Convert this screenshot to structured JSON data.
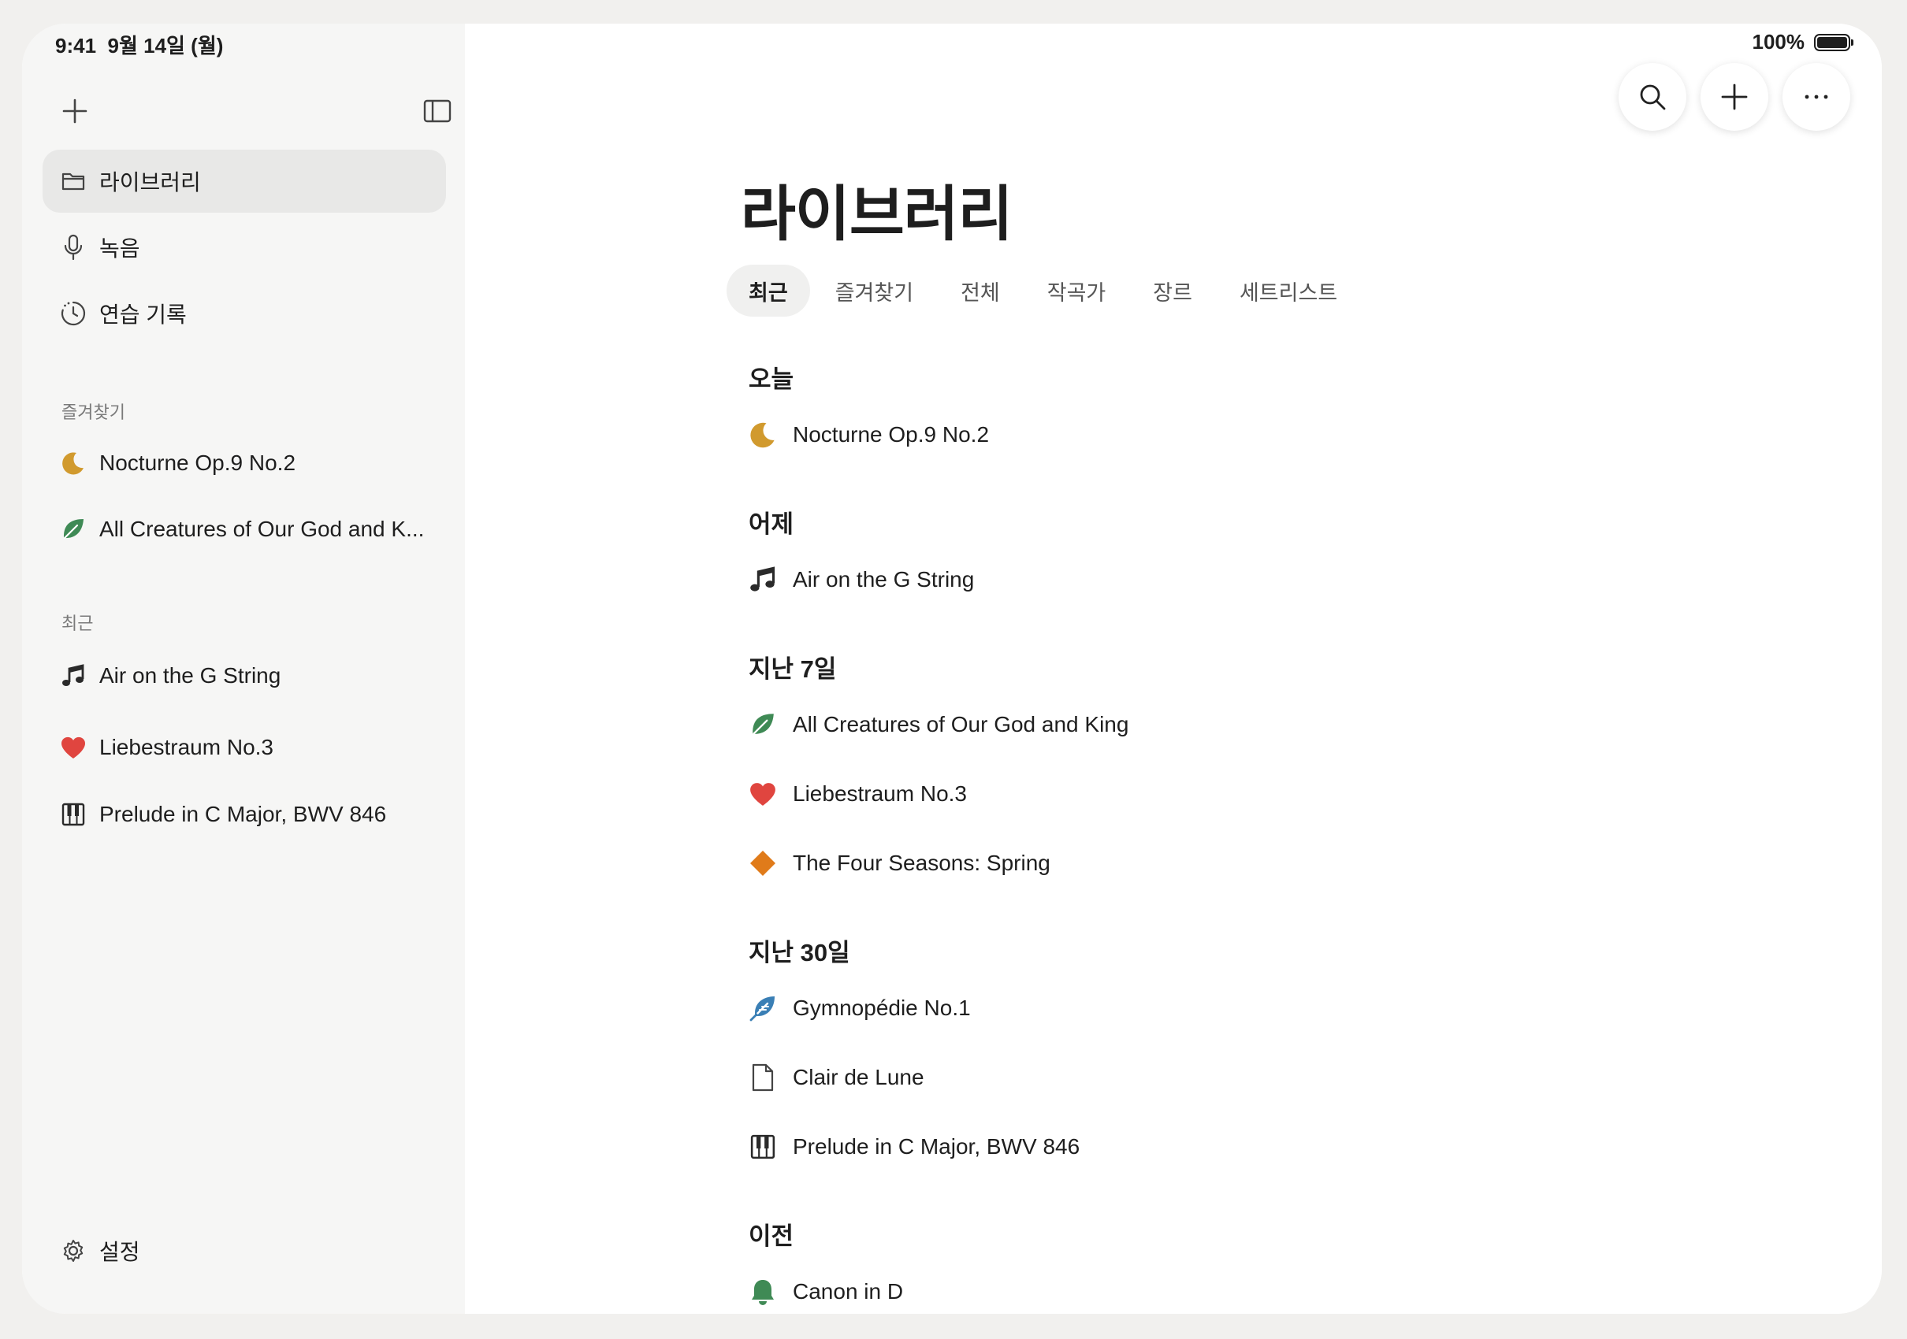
{
  "status": {
    "time": "9:41",
    "date": "9월 14일 (월)",
    "battery": "100%"
  },
  "sidebar": {
    "nav": [
      {
        "label": "라이브러리",
        "icon": "folder-icon",
        "active": true
      },
      {
        "label": "녹음",
        "icon": "microphone-icon"
      },
      {
        "label": "연습 기록",
        "icon": "history-icon"
      }
    ],
    "favorites_label": "즐겨찾기",
    "favorites": [
      {
        "label": "Nocturne Op.9 No.2",
        "icon": "moon-icon"
      },
      {
        "label": "All Creatures of Our God and K...",
        "icon": "leaf-icon"
      }
    ],
    "recent_label": "최근",
    "recent": [
      {
        "label": "Air on the G String",
        "icon": "music-note-icon"
      },
      {
        "label": "Liebestraum No.3",
        "icon": "heart-icon"
      },
      {
        "label": "Prelude in C Major, BWV 846",
        "icon": "piano-icon"
      }
    ],
    "settings_label": "설정"
  },
  "main": {
    "title": "라이브러리",
    "tabs": [
      "최근",
      "즐겨찾기",
      "전체",
      "작곡가",
      "장르",
      "세트리스트"
    ],
    "active_tab": "최근",
    "groups": [
      {
        "title": "오늘",
        "items": [
          {
            "label": "Nocturne Op.9 No.2",
            "icon": "moon-icon"
          }
        ]
      },
      {
        "title": "어제",
        "items": [
          {
            "label": "Air on the G String",
            "icon": "music-note-icon"
          }
        ]
      },
      {
        "title": "지난 7일",
        "items": [
          {
            "label": "All Creatures of Our God and King",
            "icon": "leaf-icon"
          },
          {
            "label": "Liebestraum No.3",
            "icon": "heart-icon"
          },
          {
            "label": "The Four Seasons: Spring",
            "icon": "diamond-icon"
          }
        ]
      },
      {
        "title": "지난 30일",
        "items": [
          {
            "label": "Gymnopédie No.1",
            "icon": "feather-icon"
          },
          {
            "label": "Clair de Lune",
            "icon": "document-icon"
          },
          {
            "label": "Prelude in C Major, BWV 846",
            "icon": "piano-icon"
          }
        ]
      },
      {
        "title": "이전",
        "items": [
          {
            "label": "Canon in D",
            "icon": "bell-icon"
          }
        ]
      }
    ]
  },
  "colors": {
    "moon": "#d19a2e",
    "leaf": "#3f8a55",
    "heart": "#e0453f",
    "diamond": "#e07b1a",
    "feather": "#3a7fb5",
    "bell": "#3f8a55",
    "sidebar_bg": "#f6f6f5",
    "active_bg": "#e8e8e7"
  }
}
